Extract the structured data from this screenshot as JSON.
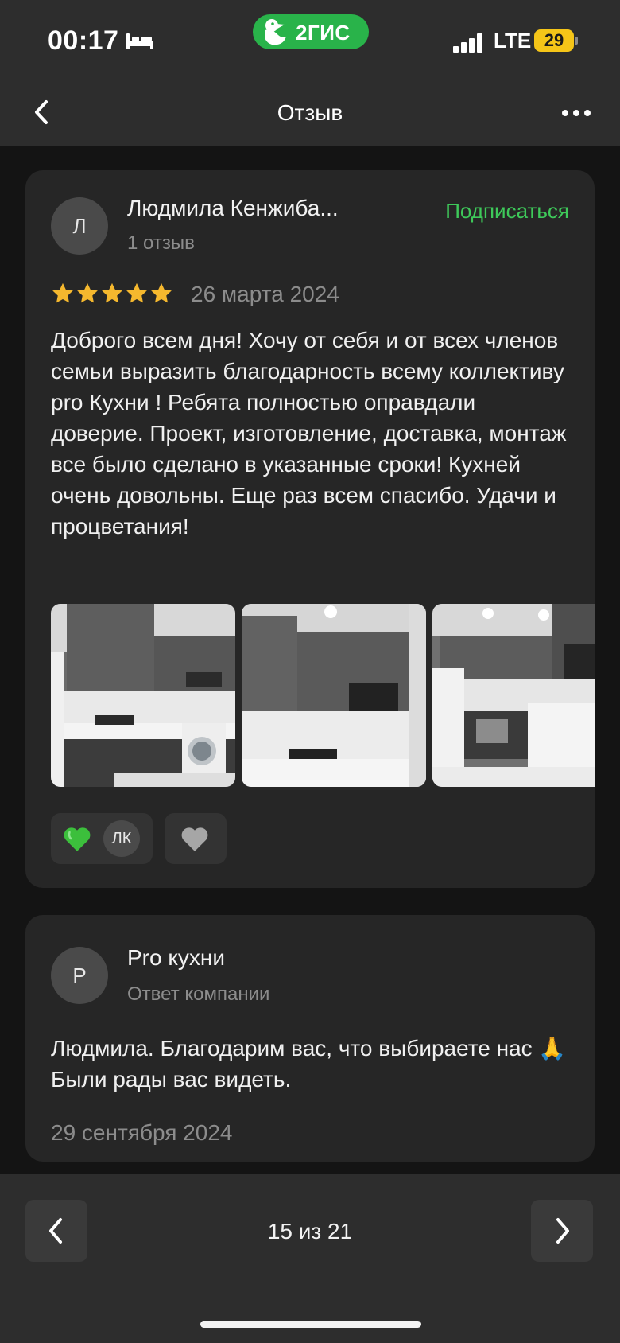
{
  "status_bar": {
    "time": "00:17",
    "brand": "2ГИС",
    "network": "LTE",
    "battery": "29",
    "icons": [
      "bed-icon",
      "duck-logo",
      "signal-icon",
      "battery-icon"
    ]
  },
  "header": {
    "title": "Отзыв",
    "icons": [
      "chevron-left-icon",
      "more-dots-icon"
    ]
  },
  "review": {
    "author_name": "Людмила Кенжиба...",
    "author_initial": "Л",
    "author_sub": "1 отзыв",
    "subscribe_label": "Подписаться",
    "rating": 5,
    "rating_max": 5,
    "date": "26 марта 2024",
    "text": "Доброго всем дня! Хочу от себя и от всех членов семьи выразить благодарность всему коллективу pro Кухни ! Ребята полностью оправдали доверие. Проект, изготовление, доставка, монтаж все было сделано в указанные сроки! Кухней очень довольны. Еще раз всем спасибо. Удачи и процветания!",
    "photos_count_visible": 3,
    "reactions": {
      "reactor_initials": "ЛК",
      "icons": [
        "green-heart-icon",
        "heart-icon"
      ]
    }
  },
  "reply": {
    "author_name": "Pro кухни",
    "author_initial": "P",
    "author_sub": "Ответ компании",
    "text": "Людмила. Благодарим вас, что выбираете нас 🙏 Были рады вас видеть.",
    "date": "29 сентября 2024"
  },
  "pager": {
    "counter": "15 из 21",
    "icons": [
      "chevron-left-icon",
      "chevron-right-icon"
    ]
  },
  "colors": {
    "accent_green": "#3ec95a",
    "brand_green": "#29b34a",
    "star_gold": "#f5b82e",
    "background": "#141414",
    "card": "#262626"
  }
}
